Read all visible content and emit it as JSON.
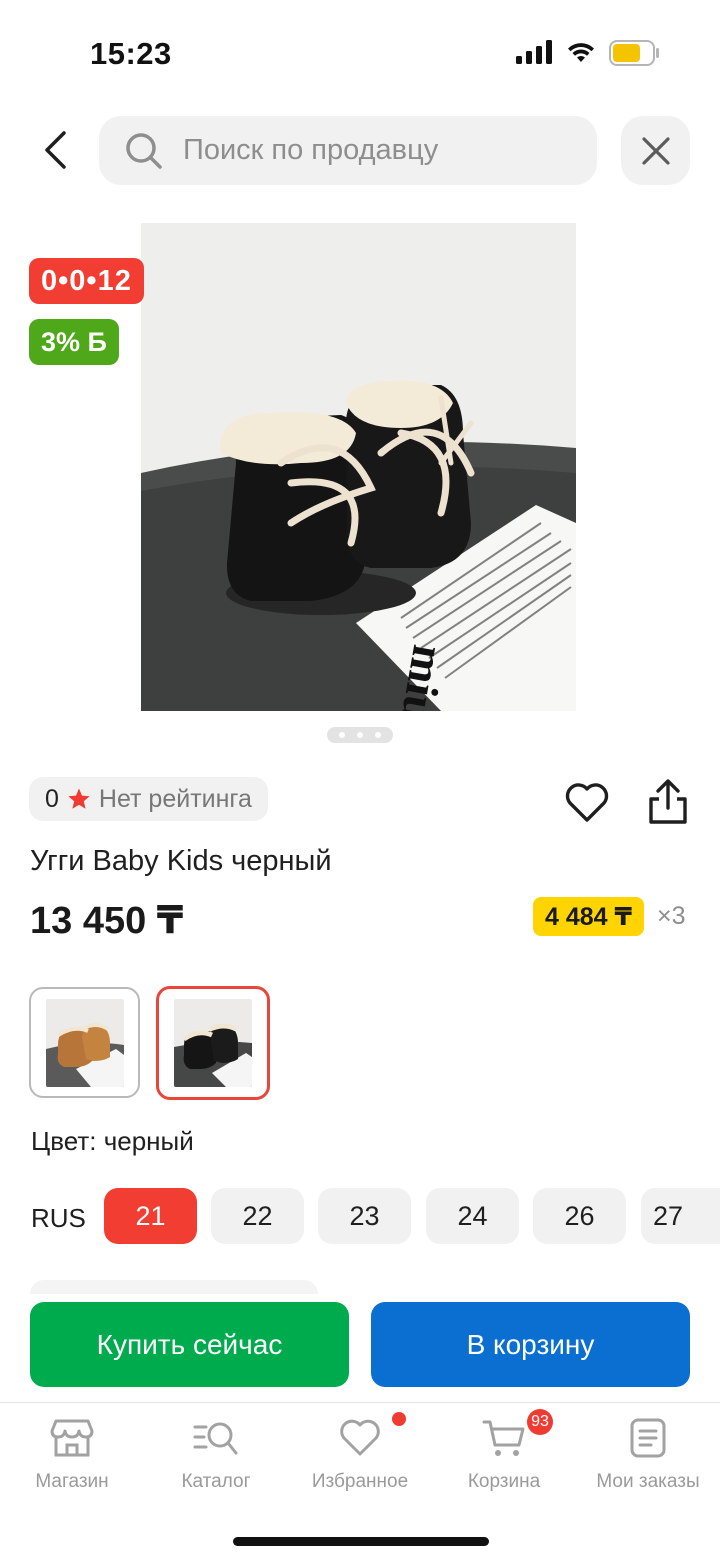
{
  "status_bar": {
    "time": "15:23"
  },
  "search": {
    "placeholder": "Поиск по продавцу"
  },
  "product": {
    "timer_badge": "0•0•12",
    "cashback_badge": "3% Б",
    "rating_count": "0",
    "rating_text": "Нет рейтинга",
    "title": "Угги Baby Kids черный",
    "price": "13 450 ₸",
    "installment_price": "4 484 ₸",
    "installment_multiplier": "×3",
    "color_label": "Цвет: черный",
    "image_pages": 3,
    "current_image": 1
  },
  "sizes": {
    "scale": "RUS",
    "options": [
      "21",
      "22",
      "23",
      "24",
      "26",
      "27"
    ],
    "selected": "21"
  },
  "actions": {
    "buy_now": "Купить сейчас",
    "add_to_cart": "В корзину"
  },
  "tabs": [
    {
      "label": "Магазин",
      "icon": "store-icon"
    },
    {
      "label": "Каталог",
      "icon": "catalog-icon"
    },
    {
      "label": "Избранное",
      "icon": "heart-icon"
    },
    {
      "label": "Корзина",
      "icon": "cart-icon",
      "badge": "93"
    },
    {
      "label": "Мои заказы",
      "icon": "orders-icon"
    }
  ],
  "colors": {
    "accent_red": "#f23d33",
    "buy_green": "#00ab4e",
    "cart_blue": "#0b6fd1",
    "installment_yellow": "#ffd400",
    "cashback_green": "#4fa81a"
  }
}
